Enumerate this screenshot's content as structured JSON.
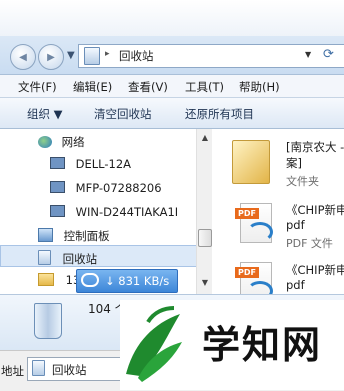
{
  "address": {
    "back_glyph": "◀",
    "forward_glyph": "▶",
    "dropdown_glyph": "▼",
    "path_separator": "▸",
    "path": "回收站",
    "refresh_glyph": "⟳"
  },
  "menubar": {
    "items": [
      "文件(F)",
      "编辑(E)",
      "查看(V)",
      "工具(T)",
      "帮助(H)"
    ]
  },
  "toolbar": {
    "organize": "组织 ▼",
    "empty": "清空回收站",
    "restore_all": "还原所有项目"
  },
  "nav": {
    "network": "网络",
    "computers": [
      "DELL-12A",
      "MFP-07288206",
      "WIN-D244TIAKA1I"
    ],
    "control_panel": "控制面板",
    "recycle_bin": "回收站",
    "partial_item": "13"
  },
  "files": [
    {
      "name_lines": [
        "[南京农大 -",
        "案]"
      ],
      "type": "文件夹"
    },
    {
      "name_lines": [
        "《CHIP新申",
        "pdf"
      ],
      "type": "PDF 文件"
    },
    {
      "name_lines": [
        "《CHIP新申",
        "pdf"
      ],
      "type": ""
    }
  ],
  "pdf_tag": "PDF",
  "details": {
    "count": "104 个对象"
  },
  "speed": {
    "value": "↓ 831 KB/s"
  },
  "statusbar": {
    "label": "地址",
    "path": "回收站"
  },
  "watermark": {
    "text": "学知网"
  },
  "colors": {
    "accent": "#3d86d8",
    "selection": "#dce9f8",
    "watermark_green": "#1f8a2e"
  }
}
